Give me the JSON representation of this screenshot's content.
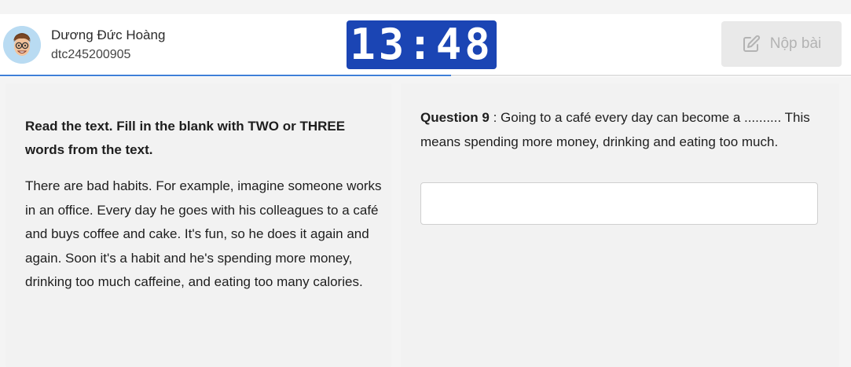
{
  "user": {
    "name": "Dương Đức Hoàng",
    "id": "dtc245200905"
  },
  "timer": {
    "display": "13:48"
  },
  "submit": {
    "label": "Nộp bài",
    "icon": "edit-icon",
    "state": "disabled"
  },
  "progress": {
    "fraction": 0.53
  },
  "passage_panel": {
    "instruction": "Read the text. Fill in the blank with TWO or THREE words from the text.",
    "text": "There are bad habits. For example, imagine someone works in an office. Every day he goes with his colleagues to a café and buys coffee and cake. It's fun, so he does it again and again. Soon it's a habit and he's spending more money, drinking too much caffeine, and eating too many calories."
  },
  "question": {
    "label": "Question 9",
    "separator": " : ",
    "text": "Going to a café every day can become a .......... This means spending more money, drinking and eating too much.",
    "answer_value": "",
    "answer_placeholder": ""
  },
  "colors": {
    "timer_bg": "#1b45b4",
    "progress": "#3f7fd8",
    "submit_disabled_bg": "#e9e9e9",
    "submit_disabled_text": "#b3b3b3"
  }
}
